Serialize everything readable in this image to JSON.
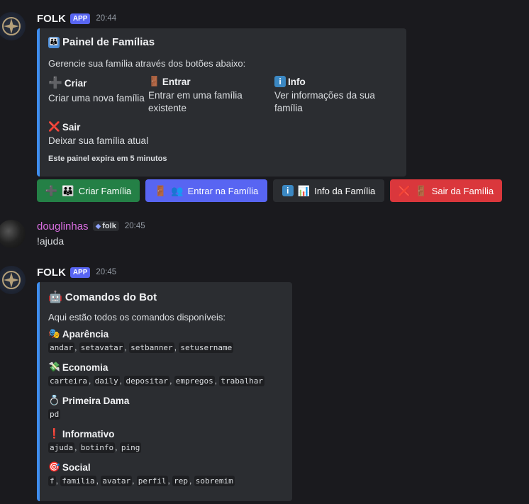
{
  "messages": [
    {
      "author": "FOLK",
      "badge": "APP",
      "time": "20:44",
      "embed": {
        "title": "Painel de Famílias",
        "description": "Gerencie sua família através dos botões abaixo:",
        "fields": [
          {
            "icon": "➕",
            "name": "Criar",
            "value": "Criar uma nova família"
          },
          {
            "icon": "🚪",
            "name": "Entrar",
            "value": "Entrar em uma família existente"
          },
          {
            "icon": "ℹ",
            "name": "Info",
            "value": "Ver informações da sua família"
          },
          {
            "icon": "❌",
            "name": "Sair",
            "value": "Deixar sua família atual"
          }
        ],
        "footer": "Este painel expira em 5 minutos"
      },
      "buttons": [
        {
          "label": "Criar Família",
          "emoji": "➕",
          "emoji2": "👪",
          "color": "#248046"
        },
        {
          "label": "Entrar na Família",
          "emoji": "🚪",
          "emoji2": "👥",
          "color": "#5865f2"
        },
        {
          "label": "Info da Família",
          "emoji": "ℹ",
          "emoji2": "📊",
          "color": "#2b2d31"
        },
        {
          "label": "Sair da Família",
          "emoji": "❌",
          "emoji2": "🚪",
          "color": "#da373c"
        }
      ]
    },
    {
      "author": "douglinhas",
      "tag": "folk",
      "time": "20:45",
      "content": "!ajuda"
    },
    {
      "author": "FOLK",
      "badge": "APP",
      "time": "20:45",
      "embed": {
        "title": "Comandos do Bot",
        "description": "Aqui estão todos os comandos disponíveis:",
        "fields": [
          {
            "icon": "🎭",
            "name": "Aparência",
            "commands": [
              "andar",
              "setavatar",
              "setbanner",
              "setusername"
            ]
          },
          {
            "icon": "💸",
            "name": "Economia",
            "commands": [
              "carteira",
              "daily",
              "depositar",
              "empregos",
              "trabalhar"
            ]
          },
          {
            "icon": "💍",
            "name": "Primeira Dama",
            "commands": [
              "pd"
            ]
          },
          {
            "icon": "❗",
            "name": "Informativo",
            "commands": [
              "ajuda",
              "botinfo",
              "ping"
            ]
          },
          {
            "icon": "🎯",
            "name": "Social",
            "commands": [
              "f",
              "familia",
              "avatar",
              "perfil",
              "rep",
              "sobremim"
            ]
          }
        ]
      }
    }
  ],
  "colors": {
    "background": "#1a1a1e",
    "embed_bg": "#2b2d31",
    "embed_border": "#3f8ef0",
    "app_badge": "#5865f2",
    "username_pink": "#d96ee0"
  }
}
